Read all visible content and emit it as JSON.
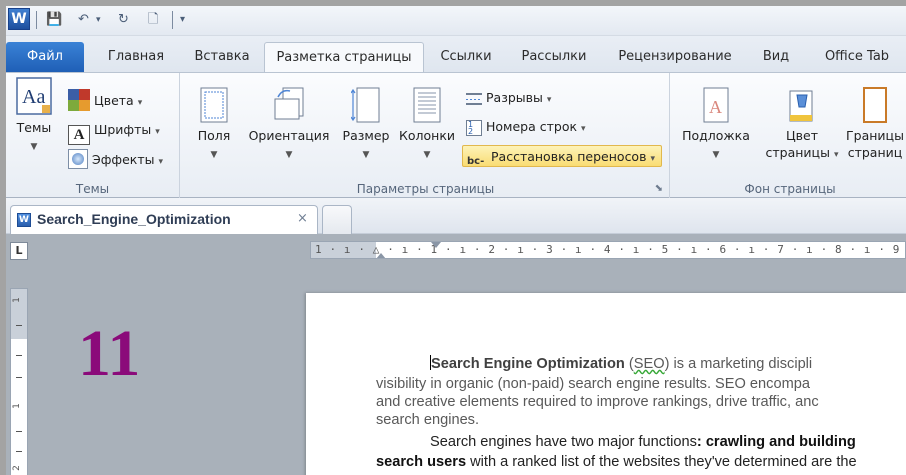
{
  "qat": {
    "logo": "W",
    "save": "💾",
    "undo": "↶",
    "undo_arrow": "▾",
    "redo": "↻",
    "new_doc": "🗋",
    "customize": "▾"
  },
  "tabs": [
    {
      "label": "Файл"
    },
    {
      "label": "Главная"
    },
    {
      "label": "Вставка"
    },
    {
      "label": "Разметка страницы"
    },
    {
      "label": "Ссылки"
    },
    {
      "label": "Рассылки"
    },
    {
      "label": "Рецензирование"
    },
    {
      "label": "Вид"
    },
    {
      "label": "Office Tab"
    }
  ],
  "ribbon": {
    "themes_group": {
      "label": "Темы",
      "themes_btn": "Темы",
      "colors": "Цвета",
      "fonts": "Шрифты",
      "effects": "Эффекты"
    },
    "page_setup_group": {
      "label": "Параметры страницы",
      "margins": "Поля",
      "orientation": "Ориентация",
      "size": "Размер",
      "columns": "Колонки",
      "breaks": "Разрывы",
      "line_numbers": "Номера строк",
      "hyphenation": "Расстановка переносов"
    },
    "page_background_group": {
      "label": "Фон страницы",
      "watermark": "Подложка",
      "page_color_line1": "Цвет",
      "page_color_line2": "страницы",
      "page_borders_line1": "Границы",
      "page_borders_line2": "страниц"
    }
  },
  "document_tab": {
    "title": "Search_Engine_Optimization",
    "close": "×"
  },
  "ruler": {
    "tab_selector": "L",
    "ticks": "1 · ı · △ · ı · 1 · ı · 2 · ı · 3 · ı · 4 · ı · 5 · ı · 6 · ı · 7 · ı · 8 · ı · 9 · ı"
  },
  "vruler": {
    "n1": "1",
    "n2": "1",
    "n3": "2"
  },
  "slide_number": "11",
  "document": {
    "p1_l1_bold": "Search Engine Optimization",
    "p1_l1_open": " (",
    "p1_l1_seo": "SEO",
    "p1_l1_rest": ")  is a marketing discipli",
    "p1_l2": "visibility in organic (non-paid) search engine results. SEO encompa",
    "p1_l3": "and creative elements required to improve rankings, drive traffic, anc",
    "p1_l4": "search engines.",
    "p2_l1_start": "Search engines have two major functions",
    "p2_l1_bold": ": crawling and building",
    "p2_l2_bold": "search users",
    "p2_l2_rest": " with a ranked list of the websites they've determined are the"
  }
}
